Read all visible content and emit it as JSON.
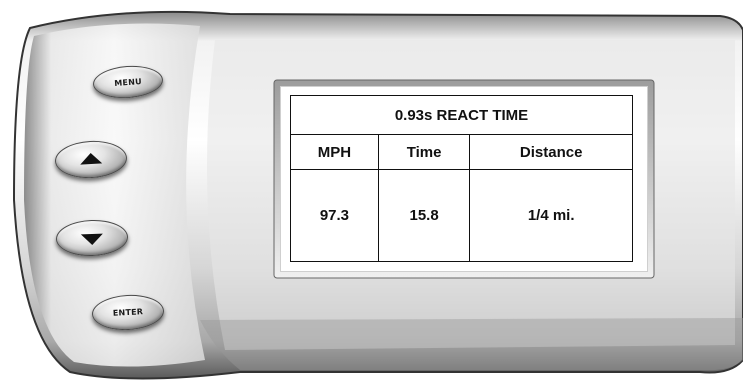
{
  "device": {
    "body_color": "#d8d8d8",
    "screen_color": "#ffffff",
    "buttons": {
      "menu_label": "MENU",
      "up_icon": "arrow-up-icon",
      "down_icon": "arrow-down-icon",
      "enter_label": "ENTER"
    }
  },
  "readout": {
    "title": "0.93s REACT TIME",
    "columns": [
      "MPH",
      "Time",
      "Distance"
    ],
    "values": [
      "97.3",
      "15.8",
      "1/4 mi."
    ]
  }
}
